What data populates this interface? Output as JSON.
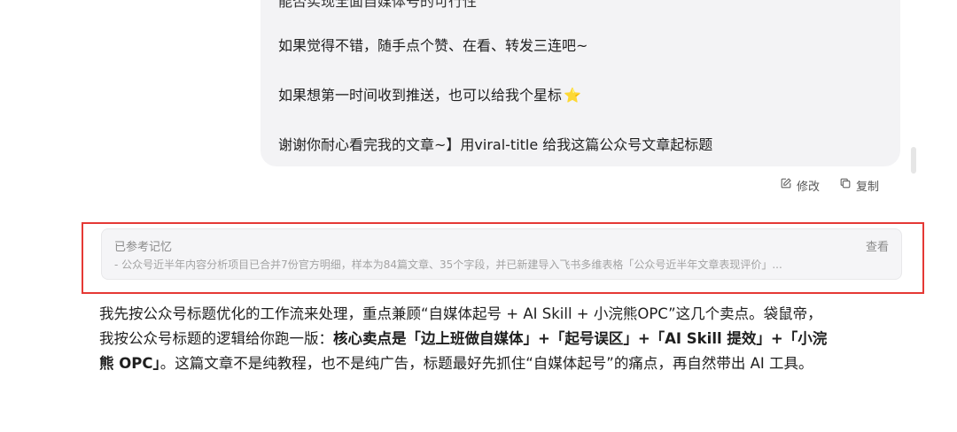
{
  "user_message": {
    "cut_line": "能否实现全面自媒体号的可行性",
    "lines": [
      "如果觉得不错，随手点个赞、在看、转发三连吧~",
      "如果想第一时间收到推送，也可以给我个星标",
      "谢谢你耐心看完我的文章~】用viral-title 给我这篇公众号文章起标题"
    ],
    "star_glyph": "⭐"
  },
  "actions": {
    "edit_label": "修改",
    "copy_label": "复制"
  },
  "memory": {
    "title": "已参考记忆",
    "view_label": "查看",
    "detail": "- 公众号近半年内容分析项目已合并7份官方明细，样本为84篇文章、35个字段，并已新建导入飞书多维表格「公众号近半年文章表现评价」..."
  },
  "answer": {
    "line1": "我先按公众号标题优化的工作流来处理，重点兼顾“自媒体起号 + AI Skill + 小浣熊OPC”这几个卖点。袋鼠帝，",
    "line2_prefix": "我按公众号标题的逻辑给你跑一版：",
    "line2_bold": "核心卖点是「边上班做自媒体」+「起号误区」+「AI Skill 提效」+「小浣",
    "line3_bold": "熊 OPC」",
    "line3_rest": "。这篇文章不是纯教程，也不是纯广告，标题最好先抓住“自媒体起号”的痛点，再自然带出 AI 工具。"
  },
  "colors": {
    "highlight": "#e53935",
    "bubble_bg": "#f3f3f5",
    "memory_bg": "#f5f5f7"
  }
}
